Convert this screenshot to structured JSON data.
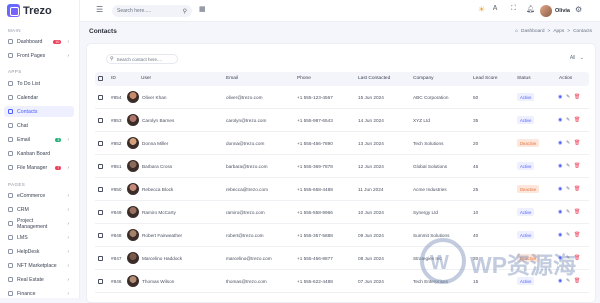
{
  "app": {
    "name": "Trezo"
  },
  "topbar": {
    "search_placeholder": "Search here.....",
    "user_name": "Olivia"
  },
  "sidebar": {
    "sections": [
      {
        "label": "MAIN"
      },
      {
        "label": "APPS"
      },
      {
        "label": "PAGES"
      }
    ],
    "items": [
      {
        "label": "Dashboard",
        "badge": "10",
        "badge_color": "#ee3e5a"
      },
      {
        "label": "Front Pages"
      },
      {
        "label": "To Do List"
      },
      {
        "label": "Calendar"
      },
      {
        "label": "Contacts"
      },
      {
        "label": "Chat"
      },
      {
        "label": "Email",
        "badge": "3",
        "badge_color": "#25b27a"
      },
      {
        "label": "Kanban Board"
      },
      {
        "label": "File Manager",
        "badge": "7",
        "badge_color": "#ee3e5a"
      },
      {
        "label": "eCommerce"
      },
      {
        "label": "CRM"
      },
      {
        "label": "Project Management"
      },
      {
        "label": "LMS"
      },
      {
        "label": "HelpDesk"
      },
      {
        "label": "NFT Marketplace"
      },
      {
        "label": "Real Estate"
      },
      {
        "label": "Finance"
      }
    ]
  },
  "page": {
    "title": "Contacts",
    "breadcrumb": [
      "Dashboard",
      ">",
      "Apps",
      ">",
      "Contacts"
    ]
  },
  "contacts": {
    "search_placeholder": "Search contact here....",
    "filter_value": "All",
    "columns": [
      "ID",
      "User",
      "Email",
      "Phone",
      "Last Contacted",
      "Company",
      "Lead Score",
      "Status",
      "Action"
    ],
    "rows": [
      {
        "id": "#854",
        "name": "Oliver Khan",
        "email": "oliver@trezo.com",
        "phone": "+1 555-123-4567",
        "last": "15 Jun 2024",
        "company": "ABC Corporation",
        "score": "50",
        "status": "Active"
      },
      {
        "id": "#853",
        "name": "Carolyn Barnes",
        "email": "carolyn@trezo.com",
        "phone": "+1 555-987-6543",
        "last": "14 Jun 2024",
        "company": "XYZ Ltd",
        "score": "35",
        "status": "Active"
      },
      {
        "id": "#852",
        "name": "Donna Miller",
        "email": "donna@trezo.com",
        "phone": "+1 555-456-7890",
        "last": "13 Jun 2024",
        "company": "Tech Solutions",
        "score": "20",
        "status": "Deactive"
      },
      {
        "id": "#851",
        "name": "Barbara Cross",
        "email": "barbara@trezo.com",
        "phone": "+1 555-369-7878",
        "last": "12 Jun 2024",
        "company": "Global Solutions",
        "score": "45",
        "status": "Active"
      },
      {
        "id": "#850",
        "name": "Rebecca Block",
        "email": "rebecca@trezo.com",
        "phone": "+1 555-658-4488",
        "last": "11 Jun 2024",
        "company": "Acme Industries",
        "score": "25",
        "status": "Deactive"
      },
      {
        "id": "#849",
        "name": "Ramiro McCarty",
        "email": "ramiro@trezo.com",
        "phone": "+1 555-558-9966",
        "last": "10 Jun 2024",
        "company": "Synergy Ltd",
        "score": "10",
        "status": "Active"
      },
      {
        "id": "#848",
        "name": "Robert Fairweather",
        "email": "robert@trezo.com",
        "phone": "+1 555-357-5888",
        "last": "09 Jun 2024",
        "company": "Summit Solutions",
        "score": "40",
        "status": "Active"
      },
      {
        "id": "#847",
        "name": "Marcelino Haddock",
        "email": "marcelino@trezo.com",
        "phone": "+1 555-456-8877",
        "last": "08 Jun 2024",
        "company": "Strategies Inc",
        "score": "30",
        "status": "Deactive"
      },
      {
        "id": "#846",
        "name": "Thomas Wilson",
        "email": "thomas@trezo.com",
        "phone": "+1 555-622-4488",
        "last": "07 Jun 2024",
        "company": "Tech Enterprises",
        "score": "15",
        "status": "Active"
      }
    ]
  },
  "watermark": {
    "text": "WP资源海"
  }
}
